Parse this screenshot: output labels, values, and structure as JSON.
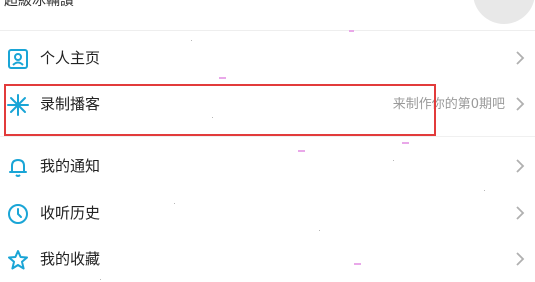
{
  "header": {
    "partial_text": "超級冰輛讚"
  },
  "menu": {
    "items": [
      {
        "label": "个人主页",
        "hint": "",
        "icon": "profile-icon"
      },
      {
        "label": "录制播客",
        "hint": "来制作你的第0期吧",
        "icon": "sparkle-icon"
      },
      {
        "label": "我的通知",
        "hint": "",
        "icon": "bell-icon"
      },
      {
        "label": "收听历史",
        "hint": "",
        "icon": "clock-icon"
      },
      {
        "label": "我的收藏",
        "hint": "",
        "icon": "star-icon"
      }
    ]
  },
  "colors": {
    "accent": "#1aa5d6",
    "highlight_border": "#e23b3b",
    "hint_text": "#9a9a9a",
    "chevron": "#b0b0b0"
  }
}
